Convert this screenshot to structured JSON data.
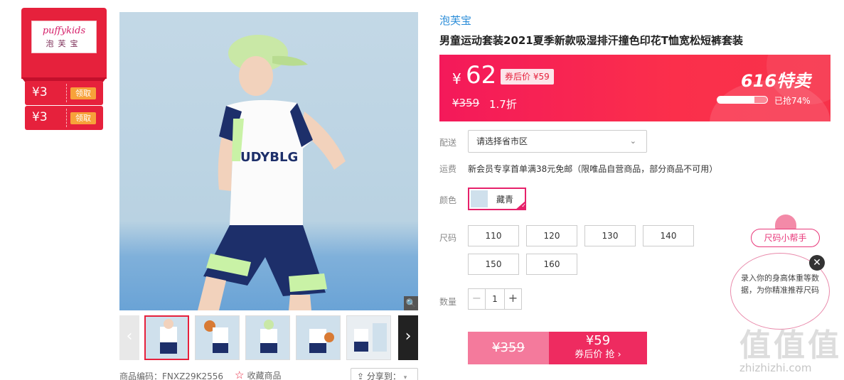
{
  "brand": {
    "logo_text": "puffykids",
    "logo_cn": "泡芙宝"
  },
  "coupons": [
    {
      "amount": "¥3",
      "action": "领取"
    },
    {
      "amount": "¥3",
      "action": "领取"
    }
  ],
  "product": {
    "shop": "泡芙宝",
    "title": "男童运动套装2021夏季新款吸湿排汗撞色印花T恤宽松短裤套装",
    "code_label": "商品编码：FNXZ29K2556",
    "favorite_label": "收藏商品",
    "share_label": "分享到："
  },
  "price_banner": {
    "yen": "¥",
    "price": "62",
    "coupon_price": "券后价 ¥59",
    "original_price": "¥359",
    "discount": "1.7折",
    "event": "616特卖",
    "sold_text": "已抢74%",
    "sold_fraction": 0.74
  },
  "delivery": {
    "label": "配送",
    "placeholder": "请选择省市区"
  },
  "shipping": {
    "label": "运费",
    "text": "新会员专享首单满38元免邮（限唯品自营商品，部分商品不可用）"
  },
  "color": {
    "label": "颜色",
    "option": "藏青"
  },
  "size": {
    "label": "尺码",
    "options": [
      "110",
      "120",
      "130",
      "140",
      "150",
      "160"
    ]
  },
  "quantity": {
    "label": "数量",
    "value": "1",
    "minus": "−",
    "plus": "+"
  },
  "buy": {
    "original": "¥359",
    "coupon_price": "¥59",
    "coupon_label": "券后价 抢 ›"
  },
  "size_helper": {
    "title": "尺码小帮手",
    "text": "录入你的身高体重等数据，为你精准推荐尺码",
    "close": "✕"
  },
  "watermark": {
    "text": "值值值",
    "url": "zhizhizhi.com"
  },
  "colors": {
    "accent": "#e6213c",
    "pink": "#ee2b60",
    "link": "#2a8cd8"
  }
}
